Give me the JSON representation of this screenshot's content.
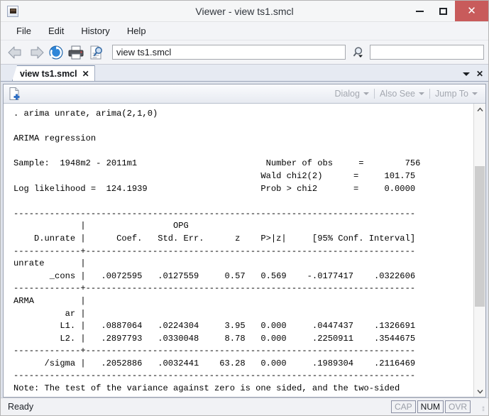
{
  "window": {
    "title": "Viewer - view ts1.smcl",
    "app_icon": "stata-viewer-icon",
    "minimize_label": "Minimize",
    "maximize_label": "Maximize",
    "close_label": "Close",
    "close_color": "#c85b5b"
  },
  "menubar": {
    "items": [
      {
        "label": "File"
      },
      {
        "label": "Edit"
      },
      {
        "label": "History"
      },
      {
        "label": "Help"
      }
    ]
  },
  "toolbar": {
    "back_icon": "back-arrow-icon",
    "forward_icon": "forward-arrow-icon",
    "refresh_icon": "refresh-icon",
    "print_icon": "print-icon",
    "find_icon": "document-search-icon",
    "address_value": "view ts1.smcl",
    "search_icon": "search-magnifier-icon",
    "search_value": "",
    "search_placeholder": ""
  },
  "tabbar": {
    "tabs": [
      {
        "label": "view ts1.smcl",
        "close_label": "✕",
        "active": true
      }
    ],
    "list_icon": "chevron-down-icon",
    "close_icon": "✕"
  },
  "commandbar": {
    "new_viewer_icon": "new-document-icon",
    "buttons": [
      {
        "label": "Dialog",
        "disabled": true
      },
      {
        "label": "Also See",
        "disabled": true
      },
      {
        "label": "Jump To",
        "disabled": true
      }
    ]
  },
  "document": {
    "content": ". arima unrate, arima(2,1,0)\n\nARIMA regression\n\nSample:  1948m2 - 2011m1                         Number of obs     =        756\n                                                Wald chi2(2)      =     101.75\nLog likelihood =  124.1939                      Prob > chi2       =     0.0000\n\n------------------------------------------------------------------------------\n             |                 OPG\n    D.unrate |      Coef.   Std. Err.      z    P>|z|     [95% Conf. Interval]\n-------------+----------------------------------------------------------------\nunrate       |\n       _cons |   .0072595   .0127559     0.57   0.569    -.0177417    .0322606\n-------------+----------------------------------------------------------------\nARMA         |\n          ar |\n         L1. |   .0887064   .0224304     3.95   0.000     .0447437    .1326691\n         L2. |   .2897793   .0330048     8.78   0.000     .2250911    .3544675\n-------------+----------------------------------------------------------------\n      /sigma |   .2052886   .0032441    63.28   0.000     .1989304    .2116469\n------------------------------------------------------------------------------\nNote: The test of the variance against zero is one sided, and the two-sided\n      confidence interval is truncated at zero.",
    "command": ". arima unrate, arima(2,1,0)",
    "heading": "ARIMA regression",
    "sample": "Sample:  1948m2 - 2011m1",
    "log_likelihood": "Log likelihood =  124.1939",
    "stats": [
      {
        "label": "Number of obs",
        "value": "756"
      },
      {
        "label": "Wald chi2(2)",
        "value": "101.75"
      },
      {
        "label": "Prob > chi2",
        "value": "0.0000"
      }
    ],
    "table": {
      "dep_var": "D.unrate",
      "vce_label": "OPG",
      "columns": [
        "Coef.",
        "Std. Err.",
        "z",
        "P>|z|",
        "[95% Conf. Interval]"
      ],
      "groups": [
        {
          "name": "unrate",
          "rows": [
            {
              "label": "_cons",
              "coef": ".0072595",
              "se": ".0127559",
              "z": "0.57",
              "p": "0.569",
              "ci_low": "-.0177417",
              "ci_high": ".0322606"
            }
          ]
        },
        {
          "name": "ARMA",
          "subgroup": "ar",
          "rows": [
            {
              "label": "L1.",
              "coef": ".0887064",
              "se": ".0224304",
              "z": "3.95",
              "p": "0.000",
              "ci_low": ".0447437",
              "ci_high": ".1326691"
            },
            {
              "label": "L2.",
              "coef": ".2897793",
              "se": ".0330048",
              "z": "8.78",
              "p": "0.000",
              "ci_low": ".2250911",
              "ci_high": ".3544675"
            }
          ]
        },
        {
          "name": "",
          "rows": [
            {
              "label": "/sigma",
              "coef": ".2052886",
              "se": ".0032441",
              "z": "63.28",
              "p": "0.000",
              "ci_low": ".1989304",
              "ci_high": ".2116469"
            }
          ]
        }
      ]
    },
    "note": "Note: The test of the variance against zero is one sided, and the two-sided\n      confidence interval is truncated at zero."
  },
  "scrollbar": {
    "up_arrow": "⌃",
    "down_arrow": "⌄",
    "thumb_top_pct": 19,
    "thumb_height_pct": 52
  },
  "statusbar": {
    "message": "Ready",
    "indicators": [
      {
        "label": "CAP",
        "active": false
      },
      {
        "label": "NUM",
        "active": true
      },
      {
        "label": "OVR",
        "active": false
      }
    ]
  }
}
